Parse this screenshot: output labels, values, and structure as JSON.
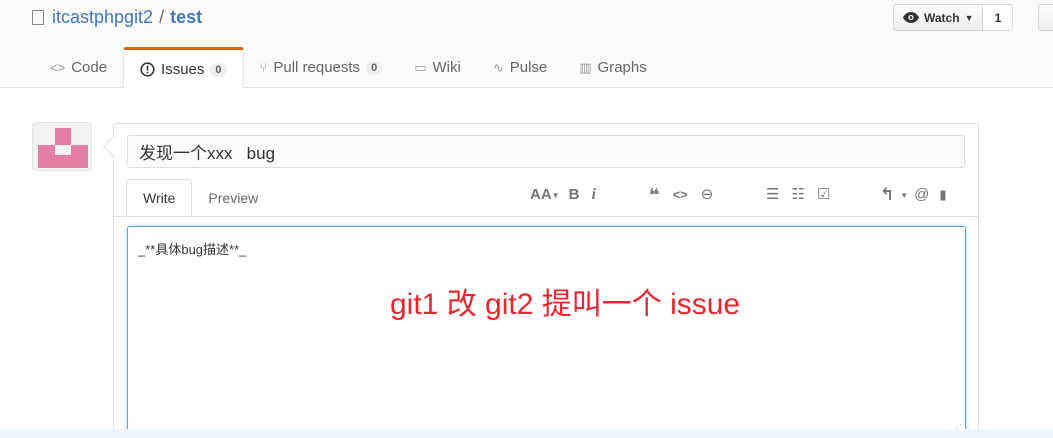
{
  "repo": {
    "owner": "itcastphpgit2",
    "separator": "/",
    "name": "test"
  },
  "watch": {
    "label": "Watch",
    "count": "1"
  },
  "tabs": [
    {
      "label": "Code",
      "icon": "<>",
      "counter": ""
    },
    {
      "label": "Issues",
      "icon": "!",
      "counter": "0"
    },
    {
      "label": "Pull requests",
      "icon": "⑂",
      "counter": "0"
    },
    {
      "label": "Wiki",
      "icon": "▭",
      "counter": ""
    },
    {
      "label": "Pulse",
      "icon": "∿",
      "counter": ""
    },
    {
      "label": "Graphs",
      "icon": "▥",
      "counter": ""
    }
  ],
  "issue": {
    "title_value": "发现一个xxx   bug",
    "write_tab": "Write",
    "preview_tab": "Preview",
    "body_text": "_**具体bug描述**_",
    "annotation": "git1   改   git2 提叫一个 issue"
  },
  "toolbar": {
    "header": "AA",
    "bold": "B",
    "italic": "i",
    "quote": "❝",
    "code": "<>",
    "link": "⊖",
    "ul": "☰",
    "ol": "☷",
    "tasks": "☑",
    "reply": "↰",
    "mention": "@",
    "bookmark": "▮"
  },
  "colors": {
    "accent": "#d26911",
    "link": "#4078c0",
    "annotation": "#e8262d",
    "avatar": "#e57ea5"
  }
}
